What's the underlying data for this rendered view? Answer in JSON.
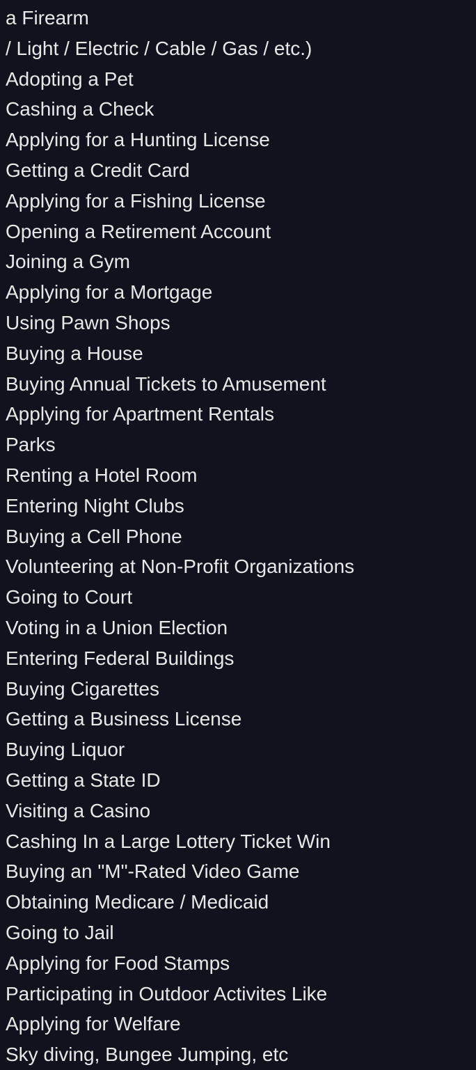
{
  "items": [
    "a Firearm",
    "/ Light / Electric / Cable / Gas / etc.)",
    "Adopting a Pet",
    "Cashing a Check",
    "Applying for a Hunting License",
    "Getting a Credit Card",
    "Applying for a Fishing License",
    "Opening a Retirement Account",
    "Joining a Gym",
    "Applying for a Mortgage",
    "Using Pawn Shops",
    "Buying a House",
    "Buying Annual Tickets to Amusement",
    "Applying for Apartment Rentals",
    "Parks",
    "Renting a Hotel Room",
    "Entering Night Clubs",
    "Buying a Cell Phone",
    "Volunteering at Non-Profit Organizations",
    "Going to Court",
    "Voting in a Union Election",
    "Entering Federal Buildings",
    "Buying Cigarettes",
    "Getting a Business License",
    "Buying Liquor",
    "Getting a State ID",
    "Visiting a Casino",
    "Cashing In a Large Lottery Ticket Win",
    "Buying an \"M\"-Rated Video Game",
    "Obtaining Medicare / Medicaid",
    "Going to Jail",
    "Applying for Food Stamps",
    "Participating in Outdoor Activites Like",
    "Applying for Welfare",
    "Sky diving, Bungee Jumping, etc"
  ]
}
